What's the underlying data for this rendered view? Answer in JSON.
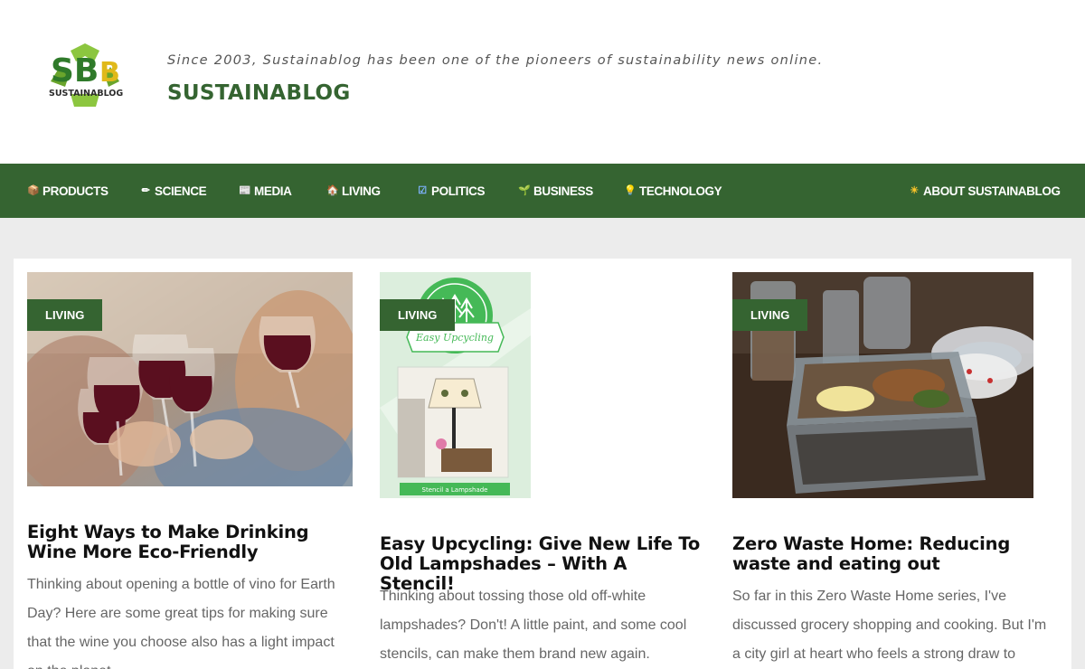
{
  "header": {
    "tagline": "Since 2003, Sustainablog has been one of the pioneers of sustainability news online.",
    "site_title": "SUSTAINABLOG",
    "logo_text": "SUSTAINABLOG",
    "logo_letters": "SB"
  },
  "nav": {
    "items": [
      {
        "label": "PRODUCTS",
        "icon": "package-icon",
        "glyph": "📦"
      },
      {
        "label": "SCIENCE",
        "icon": "pencil-icon",
        "glyph": "✏"
      },
      {
        "label": "MEDIA",
        "icon": "newspaper-icon",
        "glyph": "📰"
      },
      {
        "label": "LIVING",
        "icon": "house-icon",
        "glyph": "🏠"
      },
      {
        "label": "POLITICS",
        "icon": "checkbox-icon",
        "glyph": "☑"
      },
      {
        "label": "BUSINESS",
        "icon": "plant-icon",
        "glyph": "🌱"
      },
      {
        "label": "TECHNOLOGY",
        "icon": "bulb-icon",
        "glyph": "💡"
      },
      {
        "label": "ABOUT SUSTAINABLOG",
        "icon": "sun-icon",
        "glyph": "☀"
      }
    ]
  },
  "posts": [
    {
      "category": "LIVING",
      "title": "Eight Ways to Make Drinking Wine More Eco-Friendly",
      "excerpt": "Thinking about opening a bottle of vino for Earth Day? Here are some great tips for making sure that the wine you choose also has a light impact on the planet."
    },
    {
      "category": "LIVING",
      "title": "Easy Upcycling: Give New Life To Old Lampshades – With A Stencil!",
      "excerpt": "Thinking about tossing those old off-white lampshades? Don't! A little paint, and some cool stencils, can make them brand new again.",
      "image_text_top": "Easy Upcycling",
      "image_text_bottom": "Stencil a Lampshade"
    },
    {
      "category": "LIVING",
      "title": "Zero Waste Home: Reducing waste and eating out",
      "excerpt": "So far in this Zero Waste Home series, I've discussed grocery shopping and cooking. But I'm a city girl at heart who feels a strong draw to"
    }
  ],
  "colors": {
    "brand_green": "#356431",
    "page_bg": "#ececec",
    "text_dark": "#111111",
    "text_muted": "#666666"
  }
}
